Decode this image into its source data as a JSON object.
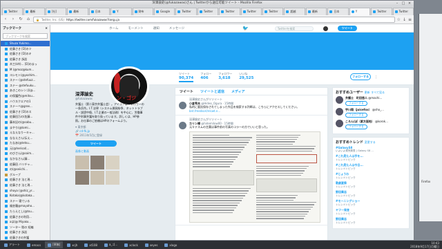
{
  "window": {
    "title": "深澤諭史(@fukazawas)さん | Twitterから送信可能ツイート - Mozilla Firefox"
  },
  "tabs": [
    "Twitter",
    "最新",
    "[社]",
    "最新",
    "日本",
    "Y",
    "財布",
    "Google",
    "Twitter",
    "Twitter",
    "Twitter",
    "Twitter",
    "Twitter",
    "超越",
    "最新",
    "日本",
    "Y",
    "Twitter",
    "Twitter"
  ],
  "nav": {
    "url_secure": "Twitter, Inc. (US)",
    "url": "https://twitter.com/fukazawas?lang=ja"
  },
  "sidebar": {
    "title": "ブックマーク",
    "close": "×",
    "search_placeholder": "ブックマークを検索",
    "items": [
      {
        "label": "Shuzo Yukimo...",
        "type": "link"
      },
      {
        "label": "佐藤さき [D]のツ",
        "type": "link"
      },
      {
        "label": "佐藤さき [D]のキ",
        "type": "link"
      },
      {
        "label": "佐藤さき 訴訟",
        "type": "link"
      },
      {
        "label": "木工(ktt)... [D]のまっ",
        "type": "link"
      },
      {
        "label": "M (@moz@kum...",
        "type": "link"
      },
      {
        "label": "ヨシモト(@yoshim...",
        "type": "link"
      },
      {
        "label": "ステー (@stefuuz...",
        "type": "link"
      },
      {
        "label": "ステー @stefuuku...",
        "type": "link"
      },
      {
        "label": "あきこのシンゴ(@...",
        "type": "link"
      },
      {
        "label": "の保護色(@mitsu...",
        "type": "link"
      },
      {
        "label": "ハウスクエアの1",
        "type": "link"
      },
      {
        "label": "ステーベ@gree...",
        "type": "link"
      },
      {
        "label": "佐藤さき [D]のス",
        "type": "link"
      },
      {
        "label": "佐藤田万の(佐藤...",
        "type": "link"
      },
      {
        "label": "藤本記の(@sabu...",
        "type": "link"
      },
      {
        "label": "まやり(@tomi...",
        "type": "link"
      },
      {
        "label": "えなえなりーキャ...",
        "type": "link"
      },
      {
        "label": "ななえさん(伝え...",
        "type": "link"
      },
      {
        "label": "たなあ(@tetsu...",
        "type": "link"
      },
      {
        "label": "元(@herisal(...",
        "type": "link"
      },
      {
        "label": "のびさん(@saim...",
        "type": "link"
      },
      {
        "label": "なかなさん(藤...",
        "type": "link"
      },
      {
        "label": "佐藤田 バリチャ...",
        "type": "link"
      },
      {
        "label": "の(@seiichi...",
        "type": "link"
      },
      {
        "label": "グループ",
        "type": "folder"
      },
      {
        "label": "佐藤さき 法と現...",
        "type": "link"
      },
      {
        "label": "佐藤さき 法と現...",
        "type": "link"
      },
      {
        "label": "shoya (@shiz_yr...",
        "type": "link"
      },
      {
        "label": "Kotaka(@kotaka...",
        "type": "link"
      },
      {
        "label": "ステー 寝ている",
        "type": "link"
      },
      {
        "label": "福芸羅@mayaho...",
        "type": "link"
      },
      {
        "label": "たらえとし(@tsu...",
        "type": "link"
      },
      {
        "label": "佐藤さきの利用...",
        "type": "link"
      },
      {
        "label": "aは(@ Miyako...",
        "type": "link"
      },
      {
        "label": "ソーター 慰の 短編",
        "type": "link"
      },
      {
        "label": "佐藤さき 訴訟",
        "type": "link"
      },
      {
        "label": "佐藤さきの弁護",
        "type": "link"
      },
      {
        "label": "グループ",
        "type": "folder"
      },
      {
        "label": "佐藤さき 行政 2(制",
        "type": "link"
      },
      {
        "label": "ステーブ(佐藤...",
        "type": "link"
      }
    ]
  },
  "twitter_nav": {
    "home": "ホーム",
    "moments": "モーメント",
    "notifications": "通知",
    "messages": "メッセージ",
    "search_placeholder": "Twitterを検索",
    "tweet_button": "ツイート"
  },
  "profile": {
    "name": "深澤諭史",
    "handle": "@fukazawas",
    "bio": "弁護士（第二東京弁護士会）。アイコンはフォロワーの一条氏作。I.T.法律（システム開発紛争、ネットトラブル・誹謗中傷、I.T.企業の一般法務）を中心に、労働事件や刑事弁護を取り扱っています。詳しくは、HP参照。お仕事のご依頼はHPのフォームより。",
    "location": "東京都",
    "website": "cd-fk.jp",
    "joined": "2011年5月に登録",
    "tweet_button": "ツイート",
    "media_label": "画像と動画",
    "stats": [
      {
        "label": "ツイート",
        "value": "90,374"
      },
      {
        "label": "フォロー",
        "value": "406"
      },
      {
        "label": "フォロワー",
        "value": "3,618"
      },
      {
        "label": "いいね",
        "value": "29,525"
      }
    ],
    "follow_button": "フォローする",
    "avatar_text": "ン・ゴジ"
  },
  "timeline": {
    "tabs": [
      "ツイート",
      "ツイートと返信",
      "メディア"
    ],
    "tweets": [
      {
        "context": "深澤諭史さんがリツイート",
        "name": "小倉秀夫",
        "handle": "@Hideo_Ogura · 15時間",
        "text": "私的に委託保存されてしまった作品を検索する判断は、こちらにアクセスしてください。",
        "link": "bnt.fmedsorl/nIcwt.n..."
      },
      {
        "context": "深澤諭史さんがリツイート",
        "name": "カリン様",
        "handle": "@hidemilow00 · 15時間",
        "text": "元々テスムの言葉は事件前の写真のコラーの方でいいと思った。"
      }
    ]
  },
  "recommend": {
    "title": "おすすめユーザー",
    "refresh": "更新",
    "all": "すべて見る",
    "follow_label": "フォローする",
    "users": [
      {
        "name": "弁護士　町田悠人",
        "handle": "@machi..."
      },
      {
        "name": "宇川翔（juicefox）",
        "handle": "@sho_..."
      },
      {
        "name": "ころん(ぽ（紫方面地）",
        "handle": "@korok..."
      }
    ]
  },
  "trends": {
    "title": "おすすめトレンド",
    "change": "変更する",
    "items": [
      {
        "name": "#GalaxyS8",
        "sub": "いよいよ発売発表 | Galaxy S8 ..."
      },
      {
        "name": "#これ見た人は手を...",
        "sub": "トレンドトピック"
      },
      {
        "name": "#これ見た人は今日...",
        "sub": "トレンドトピック"
      },
      {
        "name": "#じょうわ",
        "sub": "トレンドトピック"
      },
      {
        "name": "歌劇夏祭",
        "sub": "トレンドトピック"
      },
      {
        "name": "野田奏志",
        "sub": "トレンドトピック"
      },
      {
        "name": "#モーニングショー",
        "sub": "トレンドトピック"
      },
      {
        "name": "ヤフー発言",
        "sub": "トレンドトピック"
      },
      {
        "name": "野田奏志",
        "sub": "トレンドトピック"
      }
    ]
  },
  "taskbar": {
    "items": [
      "アラート",
      "emacs",
      "[草稿]",
      "xcjh",
      "xt108",
      "a_ゴ...",
      "xclock",
      "xeyes",
      "xlogo"
    ],
    "time": "10:43",
    "date": "2018年9月17日月曜日"
  },
  "desktop": {
    "side_label": "Firefox"
  }
}
